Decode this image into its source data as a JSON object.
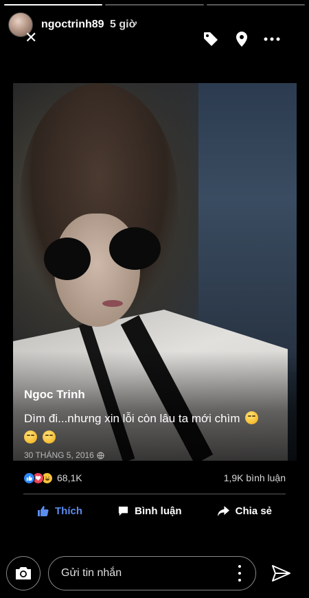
{
  "story": {
    "progress_segments": 3,
    "progress_current": 1,
    "username": "ngoctrinh89",
    "time_ago": "5 giờ"
  },
  "header_icons": [
    "close-icon",
    "tag-icon",
    "location-pin-icon",
    "more-options-icon"
  ],
  "post": {
    "author": "Ngoc Trinh",
    "text": "Dìm đi...nhưng xin lỗi còn lâu ta mới chìm",
    "date": "30 THÁNG 5, 2016",
    "privacy_icon": "globe-icon"
  },
  "stats": {
    "reactions": [
      "like",
      "love",
      "haha"
    ],
    "reaction_count": "68,1K",
    "comments": "1,9K bình luận"
  },
  "actions": {
    "like": "Thích",
    "comment": "Bình luận",
    "share": "Chia sẻ"
  },
  "footer": {
    "message_placeholder": "Gửi tin nhắn"
  },
  "colors": {
    "background": "#000000",
    "like_blue": "#5b8cf0",
    "love_red": "#f0445a",
    "haha_yellow": "#f7c23a"
  }
}
